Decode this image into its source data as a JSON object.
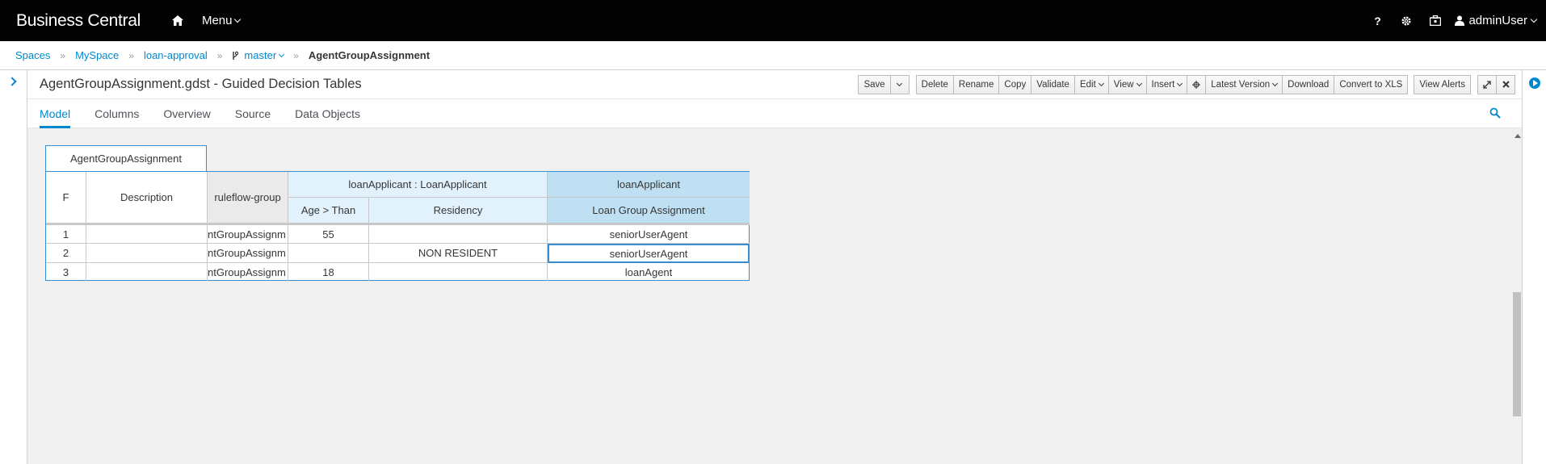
{
  "topnav": {
    "brand": "Business Central",
    "home_icon": "home-icon",
    "menu_label": "Menu",
    "user_label": "adminUser"
  },
  "breadcrumb": {
    "items": [
      "Spaces",
      "MySpace",
      "loan-approval",
      "master",
      "AgentGroupAssignment"
    ]
  },
  "editor": {
    "title": "AgentGroupAssignment.gdst - Guided Decision Tables",
    "toolbar": {
      "save": "Save",
      "delete": "Delete",
      "rename": "Rename",
      "copy": "Copy",
      "validate": "Validate",
      "edit": "Edit",
      "view": "View",
      "insert": "Insert",
      "latest_version": "Latest Version",
      "download": "Download",
      "convert": "Convert to XLS",
      "view_alerts": "View Alerts"
    },
    "tabs": [
      "Model",
      "Columns",
      "Overview",
      "Source",
      "Data Objects"
    ],
    "active_tab": "Model"
  },
  "table": {
    "name": "AgentGroupAssignment",
    "headers": {
      "f": "F",
      "description": "Description",
      "ruleflow": "ruleflow-group",
      "pattern": "loanApplicant : LoanApplicant",
      "action_pattern": "loanApplicant",
      "age": "Age > Than",
      "residency": "Residency",
      "loan_group": "Loan Group Assignment"
    },
    "rows": [
      {
        "num": "1",
        "description": "",
        "ruleflow": "ntGroupAssignm",
        "age": "55",
        "residency": "",
        "agent": "seniorUserAgent"
      },
      {
        "num": "2",
        "description": "",
        "ruleflow": "ntGroupAssignm",
        "age": "",
        "residency": "NON RESIDENT",
        "agent": "seniorUserAgent"
      },
      {
        "num": "3",
        "description": "",
        "ruleflow": "ntGroupAssignm",
        "age": "18",
        "residency": "",
        "agent": "loanAgent"
      }
    ]
  },
  "colors": {
    "accent": "#0088ce",
    "topbar": "#030303",
    "condition_header": "#e1f2fc",
    "action_header": "#bfe0f3"
  }
}
